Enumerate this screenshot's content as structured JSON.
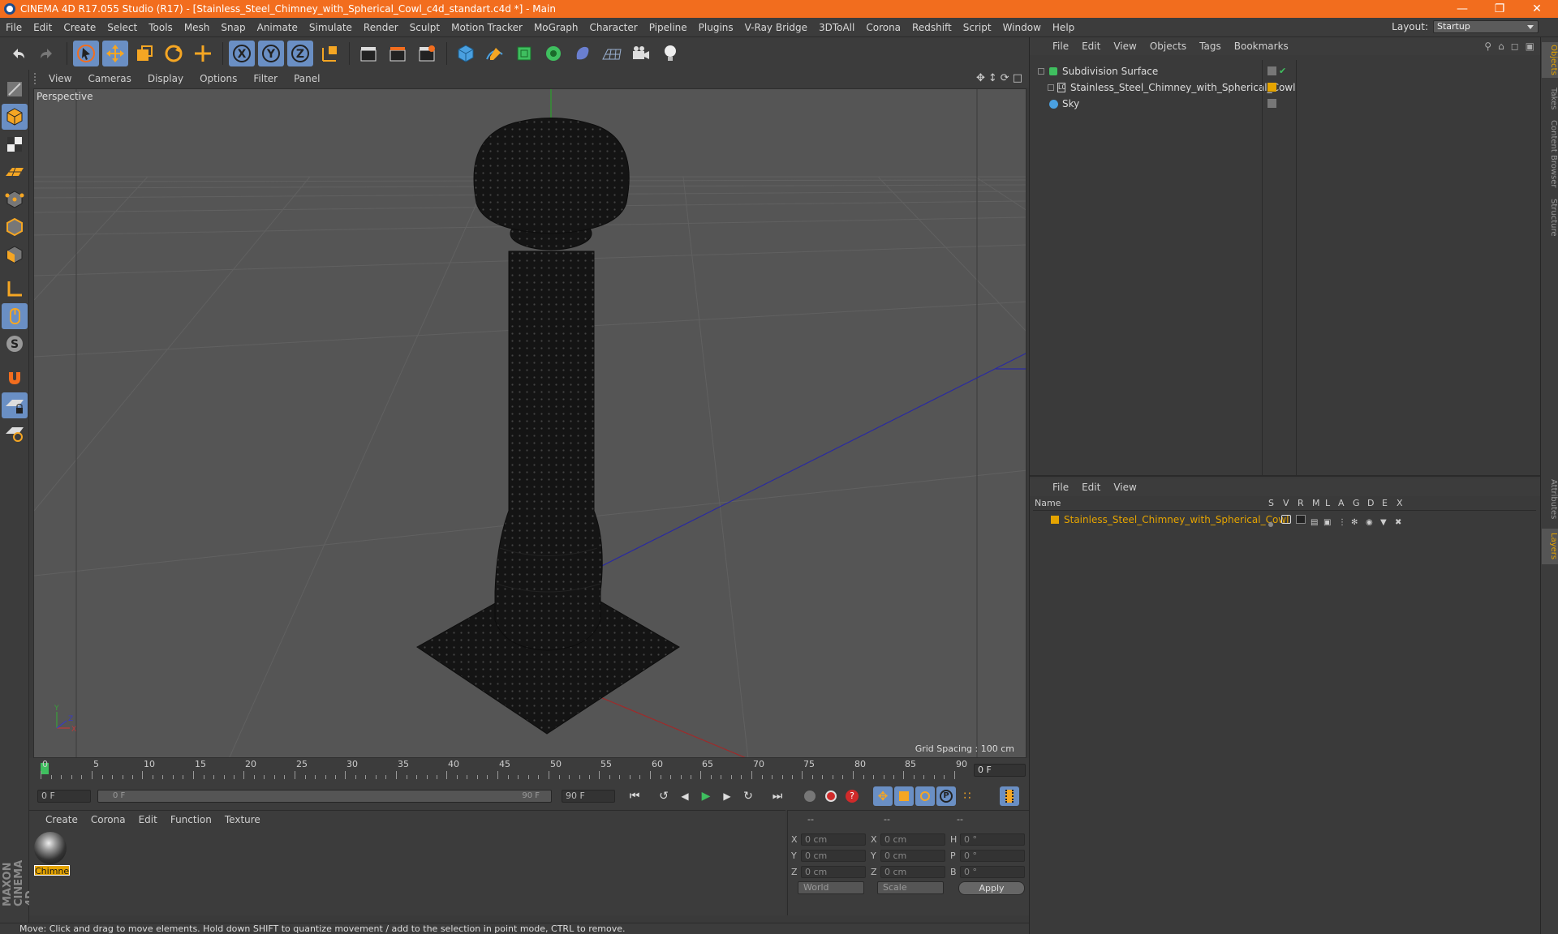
{
  "window": {
    "title": "CINEMA 4D R17.055 Studio (R17) - [Stainless_Steel_Chimney_with_Spherical_Cowl_c4d_standart.c4d *] - Main"
  },
  "menubar": {
    "items": [
      "File",
      "Edit",
      "Create",
      "Select",
      "Tools",
      "Mesh",
      "Snap",
      "Animate",
      "Simulate",
      "Render",
      "Sculpt",
      "Motion Tracker",
      "MoGraph",
      "Character",
      "Pipeline",
      "Plugins",
      "V-Ray Bridge",
      "3DToAll",
      "Corona",
      "Redshift",
      "Script",
      "Window",
      "Help"
    ],
    "layout_label": "Layout:",
    "layout_value": "Startup"
  },
  "viewport": {
    "menu": [
      "View",
      "Cameras",
      "Display",
      "Options",
      "Filter",
      "Panel"
    ],
    "camera_label": "Perspective",
    "grid_spacing": "Grid Spacing : 100 cm"
  },
  "timeline": {
    "ticks": [
      "0",
      "5",
      "10",
      "15",
      "20",
      "25",
      "30",
      "35",
      "40",
      "45",
      "50",
      "55",
      "60",
      "65",
      "70",
      "75",
      "80",
      "85",
      "90"
    ],
    "current_frame": "0 F",
    "start_frame": "0 F",
    "range_start": "0 F",
    "range_end": "90 F",
    "end_frame": "90 F"
  },
  "materials": {
    "menu": [
      "Create",
      "Corona",
      "Edit",
      "Function",
      "Texture"
    ],
    "items": [
      {
        "name": "Chimne"
      }
    ]
  },
  "coords": {
    "headers": [
      "--",
      "--",
      "--"
    ],
    "rows": [
      {
        "l1": "X",
        "v1": "0 cm",
        "l2": "X",
        "v2": "0 cm",
        "l3": "H",
        "v3": "0 °"
      },
      {
        "l1": "Y",
        "v1": "0 cm",
        "l2": "Y",
        "v2": "0 cm",
        "l3": "P",
        "v3": "0 °"
      },
      {
        "l1": "Z",
        "v1": "0 cm",
        "l2": "Z",
        "v2": "0 cm",
        "l3": "B",
        "v3": "0 °"
      }
    ],
    "world": "World",
    "scale": "Scale",
    "apply": "Apply"
  },
  "status": {
    "text": "Move: Click and drag to move elements. Hold down SHIFT to quantize movement / add to the selection in point mode, CTRL to remove."
  },
  "objects": {
    "menu": [
      "File",
      "Edit",
      "View",
      "Objects",
      "Tags",
      "Bookmarks"
    ],
    "items": [
      {
        "name": "Subdivision Surface"
      },
      {
        "name": "Stainless_Steel_Chimney_with_Spherical_Cowl"
      },
      {
        "name": "Sky"
      }
    ]
  },
  "layers": {
    "menu": [
      "File",
      "Edit",
      "View"
    ],
    "columns": [
      "Name",
      "S",
      "V",
      "R",
      "M",
      "L",
      "A",
      "G",
      "D",
      "E",
      "X"
    ],
    "items": [
      {
        "name": "Stainless_Steel_Chimney_with_Spherical_Cowl"
      }
    ]
  },
  "right_tabs": [
    "Objects",
    "Takes",
    "Content Browser",
    "Structure",
    "Attributes",
    "Layers"
  ],
  "colors": {
    "accent": "#f26d1e",
    "selection": "#6a8fc4",
    "layer_color": "#e5a400"
  }
}
